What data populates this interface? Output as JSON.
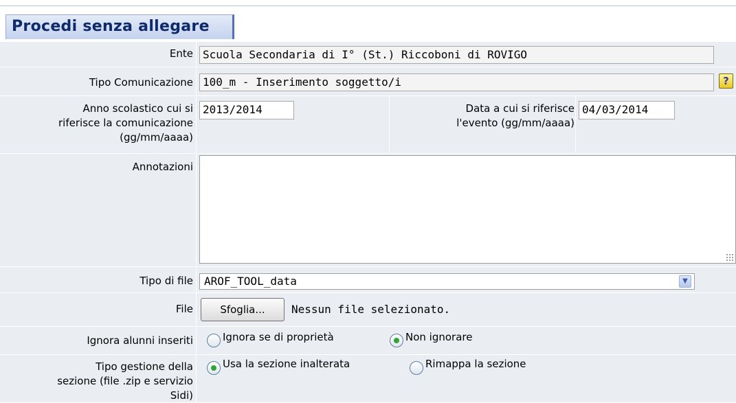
{
  "title": "Procedi senza allegare",
  "ente": {
    "label": "Ente",
    "value": "Scuola Secondaria di I° (St.) Riccoboni di ROVIGO"
  },
  "tipo_comunicazione": {
    "label": "Tipo Comunicazione",
    "value": "100_m - Inserimento soggetto/i",
    "help_icon": "help-icon"
  },
  "anno": {
    "label": "Anno scolastico cui si\nriferisce la comunicazione\n(gg/mm/aaaa)",
    "value": "2013/2014"
  },
  "data_evento": {
    "label": "Data a cui si riferisce\nl'evento (gg/mm/aaaa)",
    "value": "04/03/2014"
  },
  "annotazioni": {
    "label": "Annotazioni",
    "value": ""
  },
  "tipo_file": {
    "label": "Tipo di file",
    "selected": "AROF_TOOL_data"
  },
  "file": {
    "label": "File",
    "button": "Sfoglia...",
    "status": "Nessun file selezionato."
  },
  "ignora": {
    "label": "Ignora alunni inseriti",
    "options": [
      "Ignora se di proprietà",
      "Non ignorare"
    ],
    "selected": "Non ignorare"
  },
  "gestione": {
    "label": "Tipo gestione della\nsezione (file .zip e servizio\nSidi)",
    "options": [
      "Usa la sezione inalterata",
      "Rimappa la sezione"
    ],
    "selected": "Usa la sezione inalterata"
  },
  "colors": {
    "title": "#0f2a6b",
    "form_bg": "#eaeef2",
    "radio_selected": "#2ea535"
  }
}
